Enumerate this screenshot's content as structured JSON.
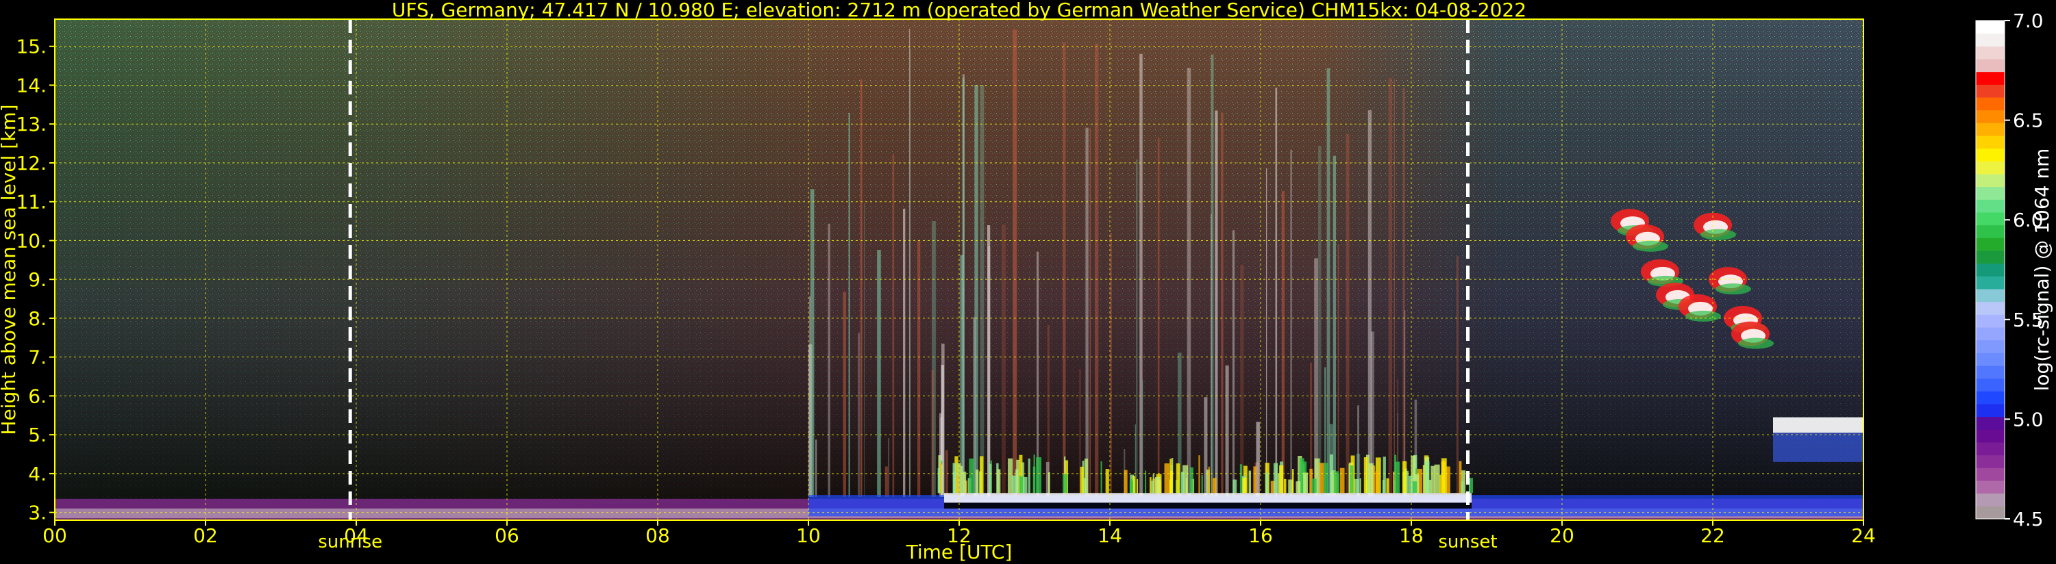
{
  "chart_data": {
    "type": "heatmap",
    "title": "UFS, Germany; 47.417 N / 10.980 E; elevation: 2712 m  (operated by German Weather Service)    CHM15kx: 04-08-2022",
    "xlabel": "Time [UTC]",
    "ylabel": "Height above mean sea level [km]",
    "xlim": [
      0,
      24
    ],
    "ylim": [
      2.8,
      15.7
    ],
    "xticks": [
      "00",
      "02",
      "04",
      "06",
      "08",
      "10",
      "12",
      "14",
      "16",
      "18",
      "20",
      "22",
      "24"
    ],
    "xtick_values": [
      0,
      2,
      4,
      6,
      8,
      10,
      12,
      14,
      16,
      18,
      20,
      22,
      24
    ],
    "yticks": [
      "3.",
      "4.",
      "5.",
      "6.",
      "7.",
      "8.",
      "9.",
      "10.",
      "11.",
      "12.",
      "13.",
      "14.",
      "15."
    ],
    "ytick_values": [
      3,
      4,
      5,
      6,
      7,
      8,
      9,
      10,
      11,
      12,
      13,
      14,
      15
    ],
    "grid": true,
    "annotations": [
      {
        "label": "sunrise",
        "x": 3.92
      },
      {
        "label": "sunset",
        "x": 18.75
      }
    ],
    "colorbar": {
      "label": "log(rc-signal) @ 1064 nm",
      "range": [
        4.5,
        7.0
      ],
      "ticks": [
        "4.5",
        "5.0",
        "5.5",
        "6.0",
        "6.5",
        "7.0"
      ],
      "tick_values": [
        4.5,
        5.0,
        5.5,
        6.0,
        6.5,
        7.0
      ],
      "colors": [
        "#a79a9c",
        "#b49ab2",
        "#b069a8",
        "#a0479e",
        "#8b2e9a",
        "#7a1c96",
        "#680d93",
        "#5b0c9a",
        "#1d2ff0",
        "#2048ff",
        "#3a63ff",
        "#5277ff",
        "#6b8cff",
        "#8099ff",
        "#94a6ff",
        "#a8b4ff",
        "#b8c7f7",
        "#87c9d6",
        "#29ad9b",
        "#159a79",
        "#1a9a3c",
        "#25ab2c",
        "#2ec24a",
        "#44d966",
        "#63e087",
        "#8ee895",
        "#c3f07b",
        "#eef241",
        "#fff200",
        "#ffd200",
        "#ffb000",
        "#ff8c00",
        "#ff6a00",
        "#f04024",
        "#ff0000",
        "#e9bcbd",
        "#f0d4d4",
        "#f4f0f0",
        "#ffffff"
      ]
    },
    "regions": [
      {
        "name": "boundary layer",
        "x": [
          0,
          24
        ],
        "y": [
          2.8,
          3.6
        ],
        "value": "4.6-5.2"
      },
      {
        "name": "low cloud layer",
        "x": [
          10,
          19
        ],
        "y": [
          3.2,
          4.4
        ],
        "value": "6.0-7.0"
      },
      {
        "name": "cirrus cloud",
        "x": [
          20.9,
          22.6
        ],
        "y": [
          7.2,
          10.6
        ],
        "value": "6.0-7.0"
      },
      {
        "name": "mid-level cloud",
        "x": [
          22.8,
          24
        ],
        "y": [
          4.3,
          6.0
        ],
        "value": "6.0-7.0"
      }
    ]
  }
}
